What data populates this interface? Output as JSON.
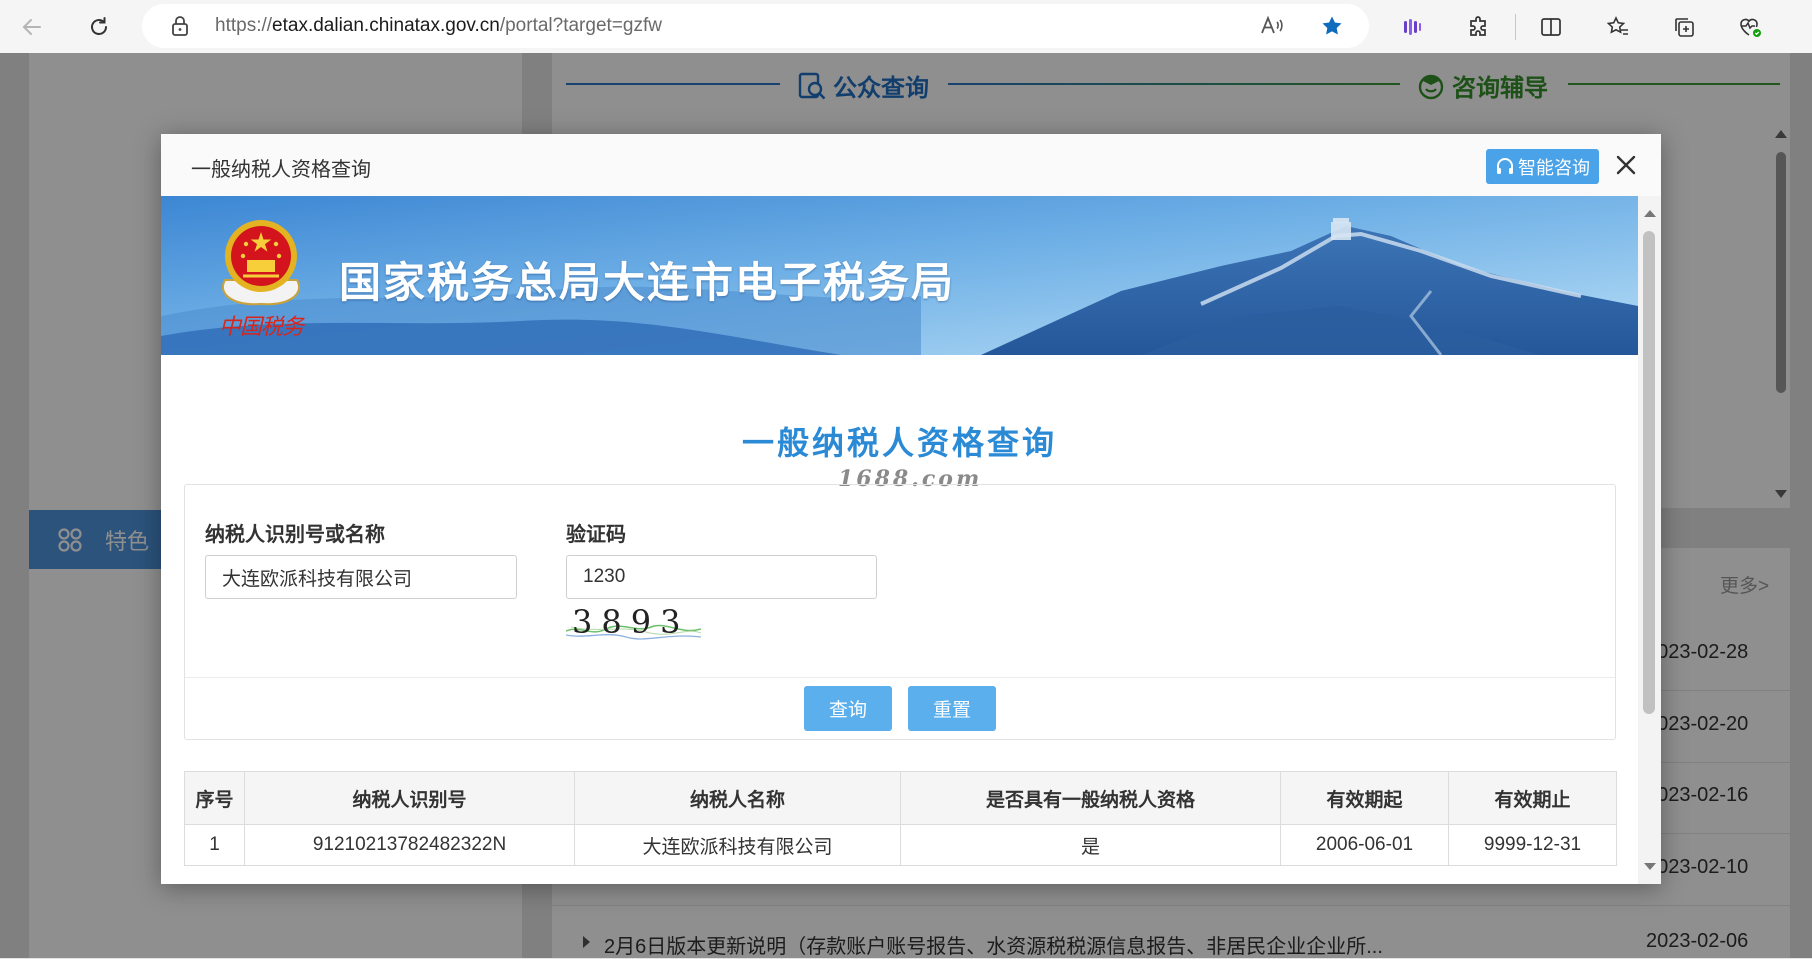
{
  "browser": {
    "url_scheme": "https://",
    "url_host": "etax.dalian.chinatax.gov.cn",
    "url_path": "/portal?target=gzfw",
    "accent_color": "#0f6cbd"
  },
  "background": {
    "section_public": "公众查询",
    "section_consult": "咨询辅导",
    "sidebar_item": "特色",
    "more_link": "更多>",
    "dates": [
      "2023-02-28",
      "2023-02-20",
      "2023-02-16",
      "2023-02-10"
    ],
    "news_bottom": {
      "title": "2月6日版本更新说明（存款账户账号报告、水资源税税源信息报告、非居民企业企业所...",
      "date": "2023-02-06"
    }
  },
  "modal": {
    "title": "一般纳税人资格查询",
    "smart_button": "智能咨询",
    "banner_title": "国家税务总局大连市电子税务局",
    "banner_logo_text": "中国税务",
    "page_title": "一般纳税人资格查询",
    "watermark": "1688.com",
    "form": {
      "taxpayer_label": "纳税人识别号或名称",
      "taxpayer_value": "大连欧派科技有限公司",
      "captcha_label": "验证码",
      "captcha_value": "1230",
      "captcha_text": "3893",
      "query_button": "查询",
      "reset_button": "重置"
    },
    "table": {
      "headers": [
        "序号",
        "纳税人识别号",
        "纳税人名称",
        "是否具有一般纳税人资格",
        "有效期起",
        "有效期止"
      ],
      "rows": [
        [
          "1",
          "91210213782482322N",
          "大连欧派科技有限公司",
          "是",
          "2006-06-01",
          "9999-12-31"
        ]
      ]
    },
    "primary_color": "#2b8ad6",
    "button_color": "#5aafec"
  }
}
